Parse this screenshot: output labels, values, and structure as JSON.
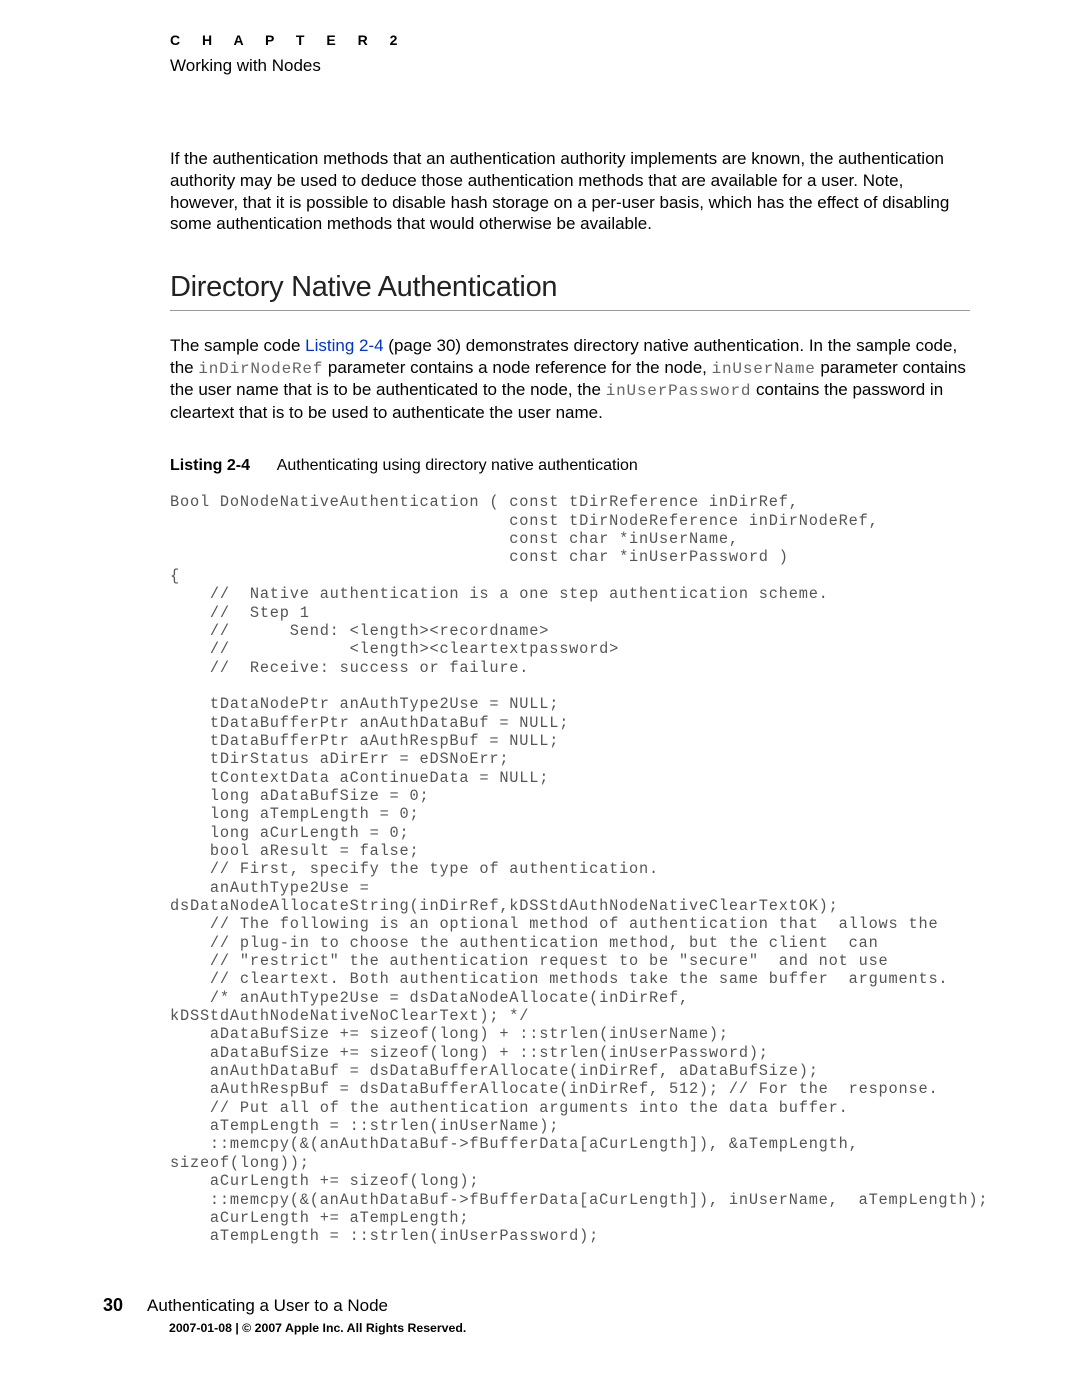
{
  "header": {
    "chapter_label": "C H A P T E R   2",
    "chapter_title": "Working with Nodes"
  },
  "intro_para": "If the authentication methods that an authentication authority implements are known, the authentication authority may be used to deduce those authentication methods that are available for a user. Note, however, that it is possible to disable hash storage on a per-user basis, which has the effect of disabling some authentication methods that would otherwise be available.",
  "section_heading": "Directory Native Authentication",
  "sample_para": {
    "t1": "The sample code ",
    "link": "Listing 2-4",
    "t2": " (page 30) demonstrates directory native authentication. In the sample code, the ",
    "c1": "inDirNodeRef",
    "t3": " parameter contains a node reference for the node, ",
    "c2": "inUserName",
    "t4": " parameter contains the user name that is to be authenticated to the node, the ",
    "c3": "inUserPassword",
    "t5": " contains the password in cleartext that is to be used to authenticate the user name."
  },
  "listing": {
    "label": "Listing 2-4",
    "caption": "Authenticating using directory native authentication"
  },
  "code": "Bool DoNodeNativeAuthentication ( const tDirReference inDirRef,\n                                  const tDirNodeReference inDirNodeRef,\n                                  const char *inUserName,\n                                  const char *inUserPassword )\n{\n    //  Native authentication is a one step authentication scheme.\n    //  Step 1\n    //      Send: <length><recordname>\n    //            <length><cleartextpassword>\n    //  Receive: success or failure.\n\n    tDataNodePtr anAuthType2Use = NULL;\n    tDataBufferPtr anAuthDataBuf = NULL;\n    tDataBufferPtr aAuthRespBuf = NULL;\n    tDirStatus aDirErr = eDSNoErr;\n    tContextData aContinueData = NULL;\n    long aDataBufSize = 0;\n    long aTempLength = 0;\n    long aCurLength = 0;\n    bool aResult = false;\n    // First, specify the type of authentication.\n    anAuthType2Use =\ndsDataNodeAllocateString(inDirRef,kDSStdAuthNodeNativeClearTextOK);\n    // The following is an optional method of authentication that  allows the\n    // plug-in to choose the authentication method, but the client  can\n    // \"restrict\" the authentication request to be \"secure\"  and not use\n    // cleartext. Both authentication methods take the same buffer  arguments.\n    /* anAuthType2Use = dsDataNodeAllocate(inDirRef,\nkDSStdAuthNodeNativeNoClearText); */\n    aDataBufSize += sizeof(long) + ::strlen(inUserName);\n    aDataBufSize += sizeof(long) + ::strlen(inUserPassword);\n    anAuthDataBuf = dsDataBufferAllocate(inDirRef, aDataBufSize);\n    aAuthRespBuf = dsDataBufferAllocate(inDirRef, 512); // For the  response.\n    // Put all of the authentication arguments into the data buffer.\n    aTempLength = ::strlen(inUserName);\n    ::memcpy(&(anAuthDataBuf->fBufferData[aCurLength]), &aTempLength,\nsizeof(long));\n    aCurLength += sizeof(long);\n    ::memcpy(&(anAuthDataBuf->fBufferData[aCurLength]), inUserName,  aTempLength);\n    aCurLength += aTempLength;\n    aTempLength = ::strlen(inUserPassword);",
  "footer": {
    "page_number": "30",
    "title": "Authenticating a User to a Node",
    "copyright": "2007-01-08   |   © 2007 Apple Inc. All Rights Reserved."
  }
}
